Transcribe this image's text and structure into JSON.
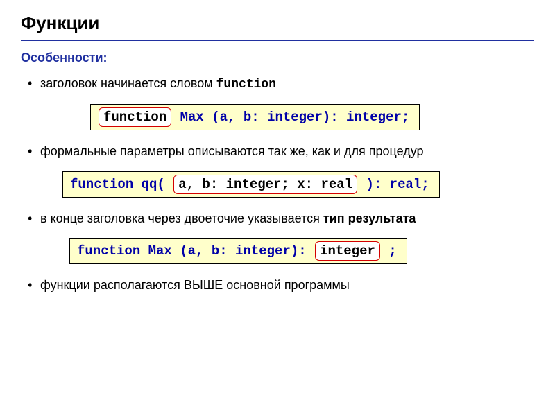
{
  "title": "Функции",
  "subtitle": "Особенности:",
  "bullets": {
    "b1_pre": "заголовок начинается словом ",
    "b1_kw": "function",
    "b2": "формальные параметры описываются так же, как и для процедур",
    "b3_pre": "в конце заголовка через двоеточие указывается ",
    "b3_bold": "тип результата",
    "b4_pre": "функции располагаются ",
    "b4_caps": "ВЫШЕ",
    "b4_post": " основной программы"
  },
  "code1": {
    "hl": "function",
    "rest": " Max (a, b: integer): integer;"
  },
  "code2": {
    "pre": "function qq( ",
    "hl": "a, b: integer; x: real",
    "post": " ): real;"
  },
  "code3": {
    "pre": "function Max (a, b: integer): ",
    "hl": "integer",
    "post": " ;"
  }
}
